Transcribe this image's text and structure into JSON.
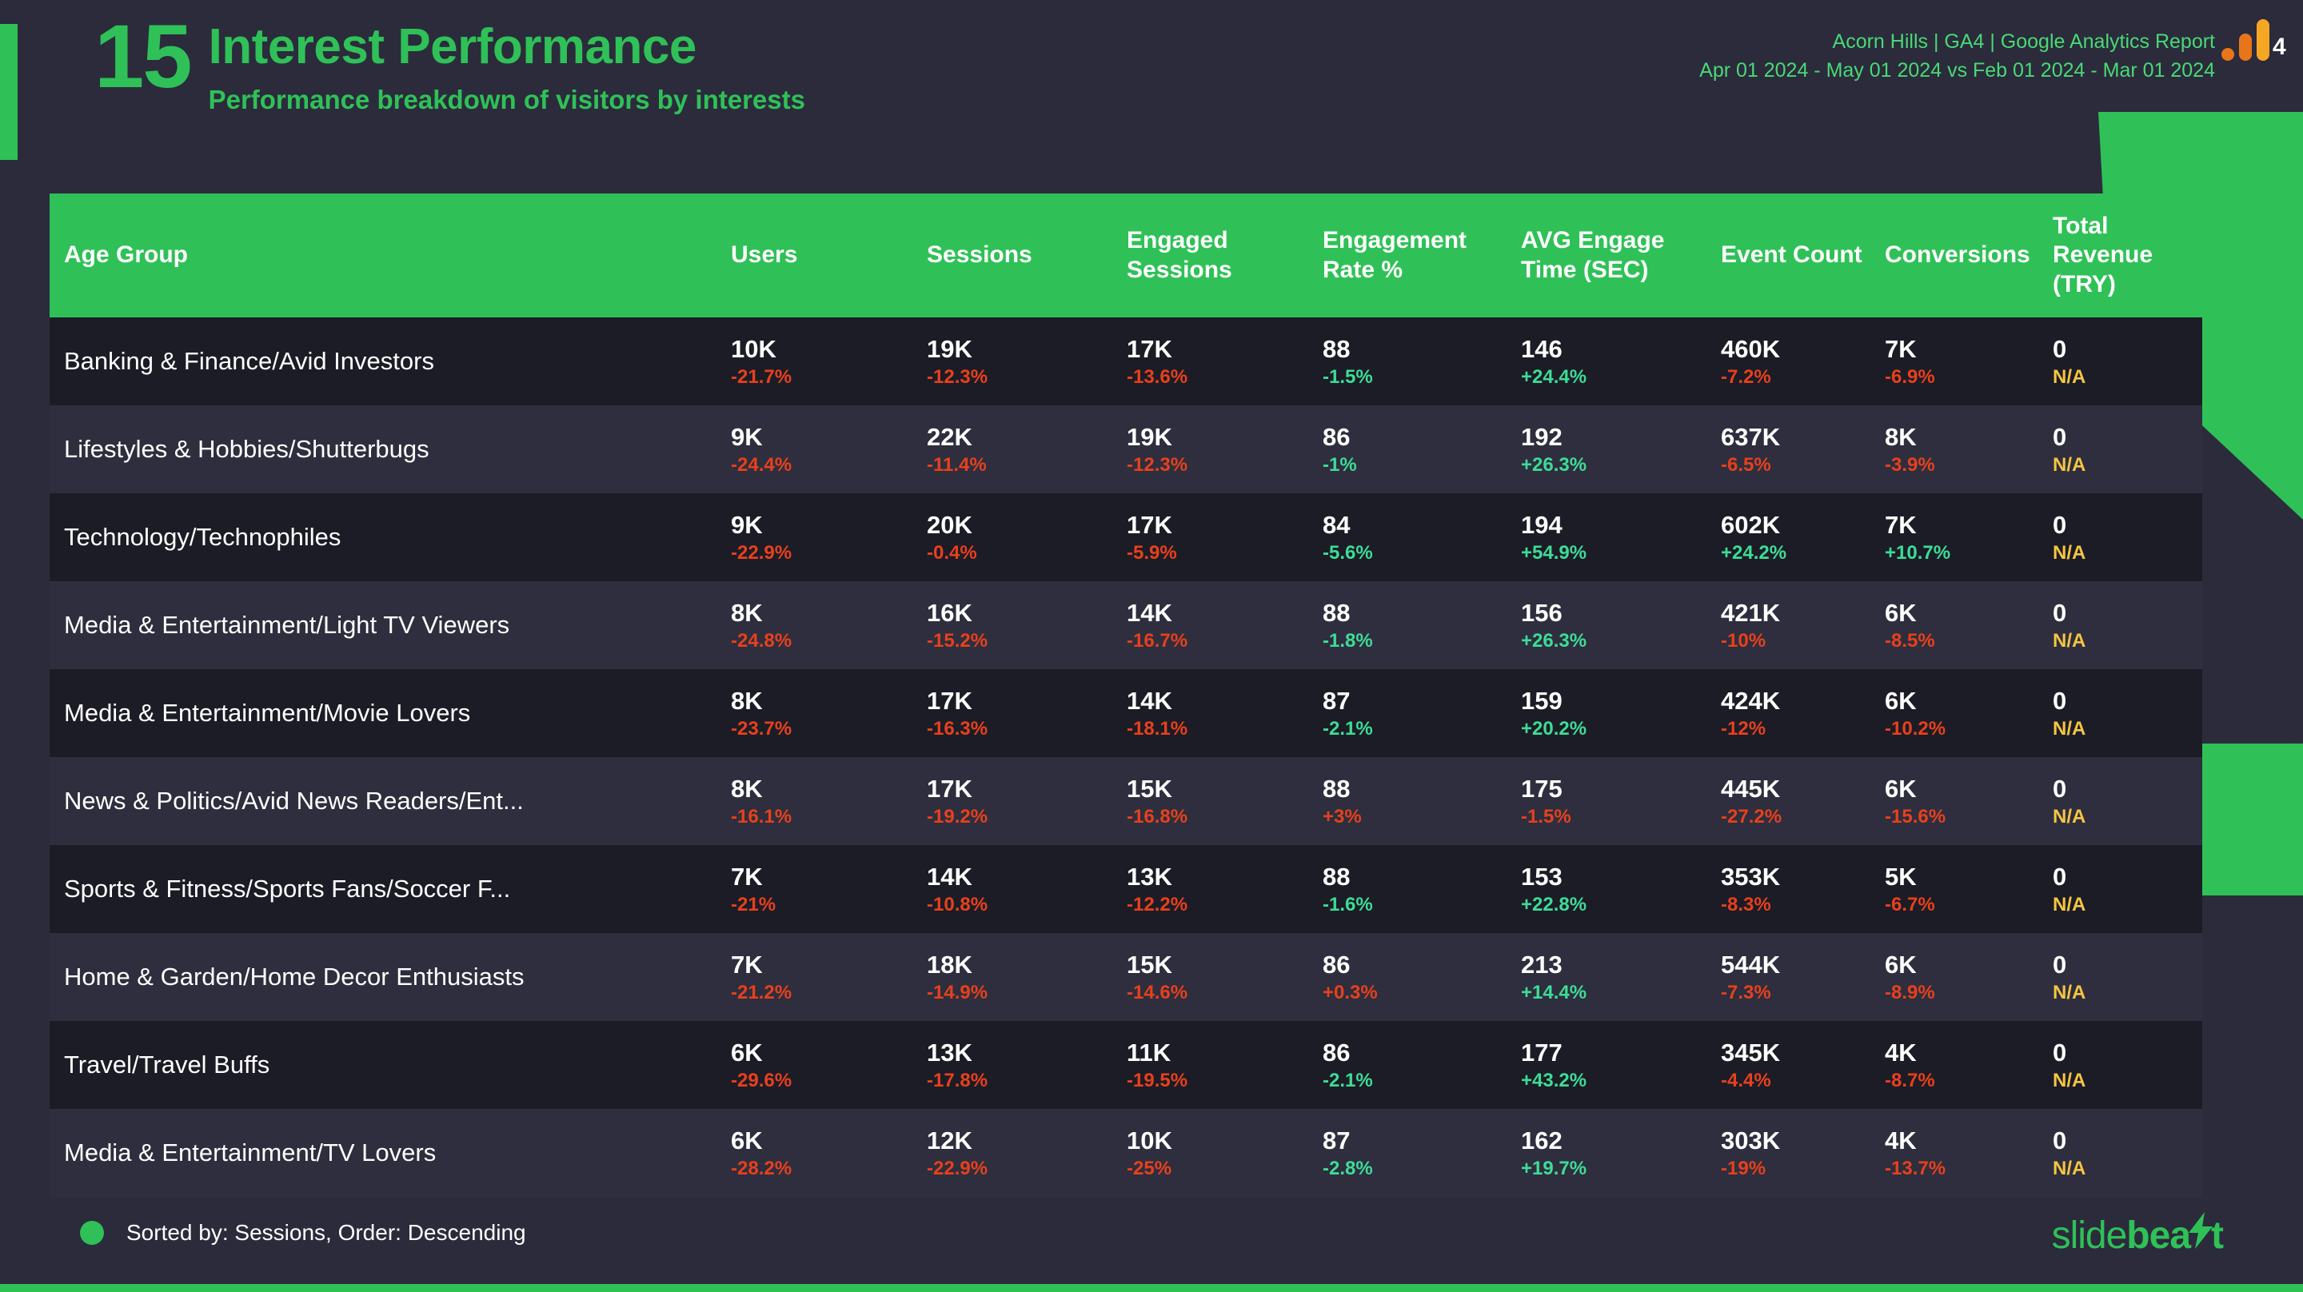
{
  "header": {
    "slide_number": "15",
    "title": "Interest Performance",
    "subtitle": "Performance breakdown of visitors by interests",
    "report_line1": "Acorn Hills | GA4 | Google Analytics Report",
    "report_line2": "Apr 01 2024 - May 01 2024 vs Feb 01 2024 - Mar 01 2024",
    "logo_name": "google-analytics-4-logo",
    "logo_badge": "4"
  },
  "colors": {
    "accent_green": "#2fc157",
    "background": "#2b2b3c",
    "row_odd": "#1c1c26",
    "row_even": "#2e2e3e",
    "positive": "#3ddc97",
    "negative": "#e8401c",
    "na": "#f5c542",
    "header_text": "#ffffff"
  },
  "table": {
    "columns": [
      "Age Group",
      "Users",
      "Sessions",
      "Engaged Sessions",
      "Engagement Rate %",
      "AVG Engage Time (SEC)",
      "Event Count",
      "Conversions",
      "Total Revenue (TRY)"
    ],
    "rows": [
      {
        "dimension": "Banking & Finance/Avid Investors",
        "cells": [
          {
            "value": "10K",
            "delta": "-21.7%",
            "tone": "neg"
          },
          {
            "value": "19K",
            "delta": "-12.3%",
            "tone": "neg"
          },
          {
            "value": "17K",
            "delta": "-13.6%",
            "tone": "neg"
          },
          {
            "value": "88",
            "delta": "-1.5%",
            "tone": "pos"
          },
          {
            "value": "146",
            "delta": "+24.4%",
            "tone": "pos"
          },
          {
            "value": "460K",
            "delta": "-7.2%",
            "tone": "neg"
          },
          {
            "value": "7K",
            "delta": "-6.9%",
            "tone": "neg"
          },
          {
            "value": "0",
            "delta": "N/A",
            "tone": "na"
          }
        ]
      },
      {
        "dimension": "Lifestyles & Hobbies/Shutterbugs",
        "cells": [
          {
            "value": "9K",
            "delta": "-24.4%",
            "tone": "neg"
          },
          {
            "value": "22K",
            "delta": "-11.4%",
            "tone": "neg"
          },
          {
            "value": "19K",
            "delta": "-12.3%",
            "tone": "neg"
          },
          {
            "value": "86",
            "delta": "-1%",
            "tone": "pos"
          },
          {
            "value": "192",
            "delta": "+26.3%",
            "tone": "pos"
          },
          {
            "value": "637K",
            "delta": "-6.5%",
            "tone": "neg"
          },
          {
            "value": "8K",
            "delta": "-3.9%",
            "tone": "neg"
          },
          {
            "value": "0",
            "delta": "N/A",
            "tone": "na"
          }
        ]
      },
      {
        "dimension": "Technology/Technophiles",
        "cells": [
          {
            "value": "9K",
            "delta": "-22.9%",
            "tone": "neg"
          },
          {
            "value": "20K",
            "delta": "-0.4%",
            "tone": "neg"
          },
          {
            "value": "17K",
            "delta": "-5.9%",
            "tone": "neg"
          },
          {
            "value": "84",
            "delta": "-5.6%",
            "tone": "pos"
          },
          {
            "value": "194",
            "delta": "+54.9%",
            "tone": "pos"
          },
          {
            "value": "602K",
            "delta": "+24.2%",
            "tone": "pos"
          },
          {
            "value": "7K",
            "delta": "+10.7%",
            "tone": "pos"
          },
          {
            "value": "0",
            "delta": "N/A",
            "tone": "na"
          }
        ]
      },
      {
        "dimension": "Media & Entertainment/Light TV Viewers",
        "cells": [
          {
            "value": "8K",
            "delta": "-24.8%",
            "tone": "neg"
          },
          {
            "value": "16K",
            "delta": "-15.2%",
            "tone": "neg"
          },
          {
            "value": "14K",
            "delta": "-16.7%",
            "tone": "neg"
          },
          {
            "value": "88",
            "delta": "-1.8%",
            "tone": "pos"
          },
          {
            "value": "156",
            "delta": "+26.3%",
            "tone": "pos"
          },
          {
            "value": "421K",
            "delta": "-10%",
            "tone": "neg"
          },
          {
            "value": "6K",
            "delta": "-8.5%",
            "tone": "neg"
          },
          {
            "value": "0",
            "delta": "N/A",
            "tone": "na"
          }
        ]
      },
      {
        "dimension": "Media & Entertainment/Movie Lovers",
        "cells": [
          {
            "value": "8K",
            "delta": "-23.7%",
            "tone": "neg"
          },
          {
            "value": "17K",
            "delta": "-16.3%",
            "tone": "neg"
          },
          {
            "value": "14K",
            "delta": "-18.1%",
            "tone": "neg"
          },
          {
            "value": "87",
            "delta": "-2.1%",
            "tone": "pos"
          },
          {
            "value": "159",
            "delta": "+20.2%",
            "tone": "pos"
          },
          {
            "value": "424K",
            "delta": "-12%",
            "tone": "neg"
          },
          {
            "value": "6K",
            "delta": "-10.2%",
            "tone": "neg"
          },
          {
            "value": "0",
            "delta": "N/A",
            "tone": "na"
          }
        ]
      },
      {
        "dimension": "News & Politics/Avid News Readers/Ent...",
        "cells": [
          {
            "value": "8K",
            "delta": "-16.1%",
            "tone": "neg"
          },
          {
            "value": "17K",
            "delta": "-19.2%",
            "tone": "neg"
          },
          {
            "value": "15K",
            "delta": "-16.8%",
            "tone": "neg"
          },
          {
            "value": "88",
            "delta": "+3%",
            "tone": "neg"
          },
          {
            "value": "175",
            "delta": "-1.5%",
            "tone": "neg"
          },
          {
            "value": "445K",
            "delta": "-27.2%",
            "tone": "neg"
          },
          {
            "value": "6K",
            "delta": "-15.6%",
            "tone": "neg"
          },
          {
            "value": "0",
            "delta": "N/A",
            "tone": "na"
          }
        ]
      },
      {
        "dimension": "Sports & Fitness/Sports Fans/Soccer F...",
        "cells": [
          {
            "value": "7K",
            "delta": "-21%",
            "tone": "neg"
          },
          {
            "value": "14K",
            "delta": "-10.8%",
            "tone": "neg"
          },
          {
            "value": "13K",
            "delta": "-12.2%",
            "tone": "neg"
          },
          {
            "value": "88",
            "delta": "-1.6%",
            "tone": "pos"
          },
          {
            "value": "153",
            "delta": "+22.8%",
            "tone": "pos"
          },
          {
            "value": "353K",
            "delta": "-8.3%",
            "tone": "neg"
          },
          {
            "value": "5K",
            "delta": "-6.7%",
            "tone": "neg"
          },
          {
            "value": "0",
            "delta": "N/A",
            "tone": "na"
          }
        ]
      },
      {
        "dimension": "Home & Garden/Home Decor Enthusiasts",
        "cells": [
          {
            "value": "7K",
            "delta": "-21.2%",
            "tone": "neg"
          },
          {
            "value": "18K",
            "delta": "-14.9%",
            "tone": "neg"
          },
          {
            "value": "15K",
            "delta": "-14.6%",
            "tone": "neg"
          },
          {
            "value": "86",
            "delta": "+0.3%",
            "tone": "neg"
          },
          {
            "value": "213",
            "delta": "+14.4%",
            "tone": "pos"
          },
          {
            "value": "544K",
            "delta": "-7.3%",
            "tone": "neg"
          },
          {
            "value": "6K",
            "delta": "-8.9%",
            "tone": "neg"
          },
          {
            "value": "0",
            "delta": "N/A",
            "tone": "na"
          }
        ]
      },
      {
        "dimension": "Travel/Travel Buffs",
        "cells": [
          {
            "value": "6K",
            "delta": "-29.6%",
            "tone": "neg"
          },
          {
            "value": "13K",
            "delta": "-17.8%",
            "tone": "neg"
          },
          {
            "value": "11K",
            "delta": "-19.5%",
            "tone": "neg"
          },
          {
            "value": "86",
            "delta": "-2.1%",
            "tone": "pos"
          },
          {
            "value": "177",
            "delta": "+43.2%",
            "tone": "pos"
          },
          {
            "value": "345K",
            "delta": "-4.4%",
            "tone": "neg"
          },
          {
            "value": "4K",
            "delta": "-8.7%",
            "tone": "neg"
          },
          {
            "value": "0",
            "delta": "N/A",
            "tone": "na"
          }
        ]
      },
      {
        "dimension": "Media & Entertainment/TV Lovers",
        "cells": [
          {
            "value": "6K",
            "delta": "-28.2%",
            "tone": "neg"
          },
          {
            "value": "12K",
            "delta": "-22.9%",
            "tone": "neg"
          },
          {
            "value": "10K",
            "delta": "-25%",
            "tone": "neg"
          },
          {
            "value": "87",
            "delta": "-2.8%",
            "tone": "pos"
          },
          {
            "value": "162",
            "delta": "+19.7%",
            "tone": "pos"
          },
          {
            "value": "303K",
            "delta": "-19%",
            "tone": "neg"
          },
          {
            "value": "4K",
            "delta": "-13.7%",
            "tone": "neg"
          },
          {
            "value": "0",
            "delta": "N/A",
            "tone": "na"
          }
        ]
      }
    ]
  },
  "footer": {
    "sort_note": "Sorted by: Sessions, Order: Descending",
    "brand_light": "slide",
    "brand_bold": "bea",
    "brand_tail": "t"
  }
}
